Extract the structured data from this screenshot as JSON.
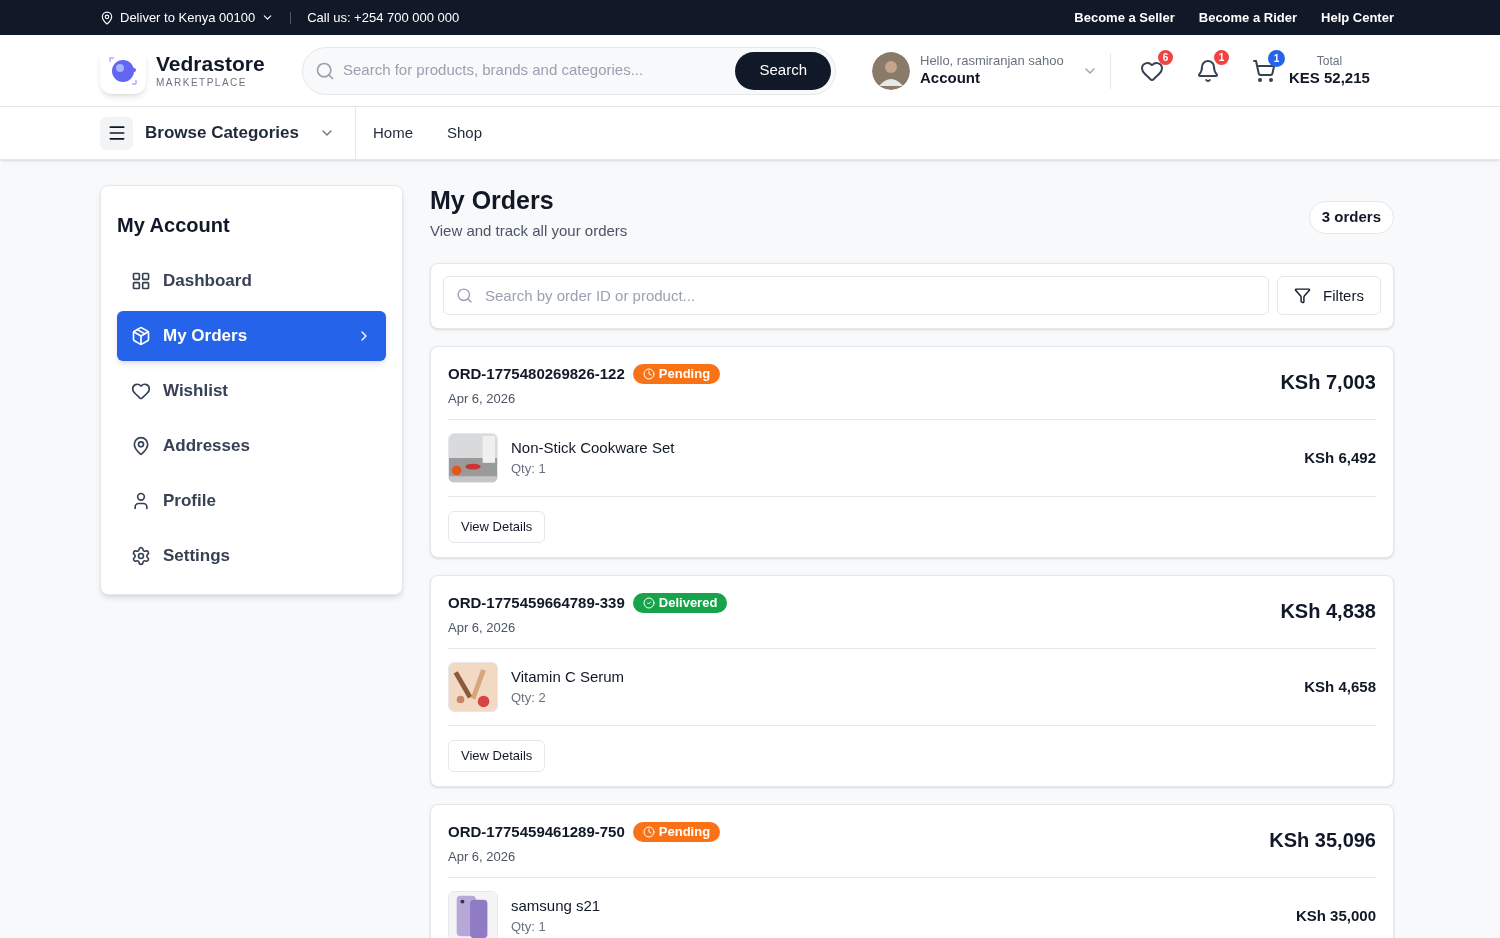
{
  "topbar": {
    "location": "Deliver to Kenya 00100",
    "phone": "Call us: +254 700 000 000",
    "links": [
      "Become a Seller",
      "Become a Rider",
      "Help Center"
    ]
  },
  "header": {
    "brand": "Vedrastore",
    "tagline": "MARKETPLACE",
    "search": {
      "placeholder": "Search for products, brands and categories...",
      "button": "Search"
    },
    "greeting": "Hello, rasmiranjan sahoo",
    "account": "Account",
    "wishlist_count": "6",
    "notification_count": "1",
    "cart_count": "1",
    "total_label": "Total",
    "total": "KES 52,215"
  },
  "nav": {
    "categories": "Browse Categories",
    "links": [
      "Home",
      "Shop"
    ]
  },
  "sidebar": {
    "title": "My Account",
    "items": [
      {
        "label": "Dashboard",
        "selected": false
      },
      {
        "label": "My Orders",
        "selected": true
      },
      {
        "label": "Wishlist",
        "selected": false
      },
      {
        "label": "Addresses",
        "selected": false
      },
      {
        "label": "Profile",
        "selected": false
      },
      {
        "label": "Settings",
        "selected": false
      }
    ]
  },
  "main": {
    "title": "My Orders",
    "subtitle": "View and track all your orders",
    "count": "3 orders",
    "search": {
      "placeholder": "Search by order ID or product..."
    },
    "filters": "Filters",
    "orders": [
      {
        "id": "ORD-1775480269826-122",
        "status": "Pending",
        "kind": "pending",
        "date": "Apr 6, 2026",
        "total": "KSh 7,003",
        "item": {
          "name": "Non-Stick Cookware Set",
          "qty": "Qty: 1",
          "price": "KSh 6,492"
        },
        "action": "View Details"
      },
      {
        "id": "ORD-1775459664789-339",
        "status": "Delivered",
        "kind": "delivered",
        "date": "Apr 6, 2026",
        "total": "KSh 4,838",
        "item": {
          "name": "Vitamin C Serum",
          "qty": "Qty: 2",
          "price": "KSh 4,658"
        },
        "action": "View Details"
      },
      {
        "id": "ORD-1775459461289-750",
        "status": "Pending",
        "kind": "pending",
        "date": "Apr 6, 2026",
        "total": "KSh 35,096",
        "item": {
          "name": "samsung s21",
          "qty": "Qty: 1",
          "price": "KSh 35,000"
        }
      }
    ]
  }
}
